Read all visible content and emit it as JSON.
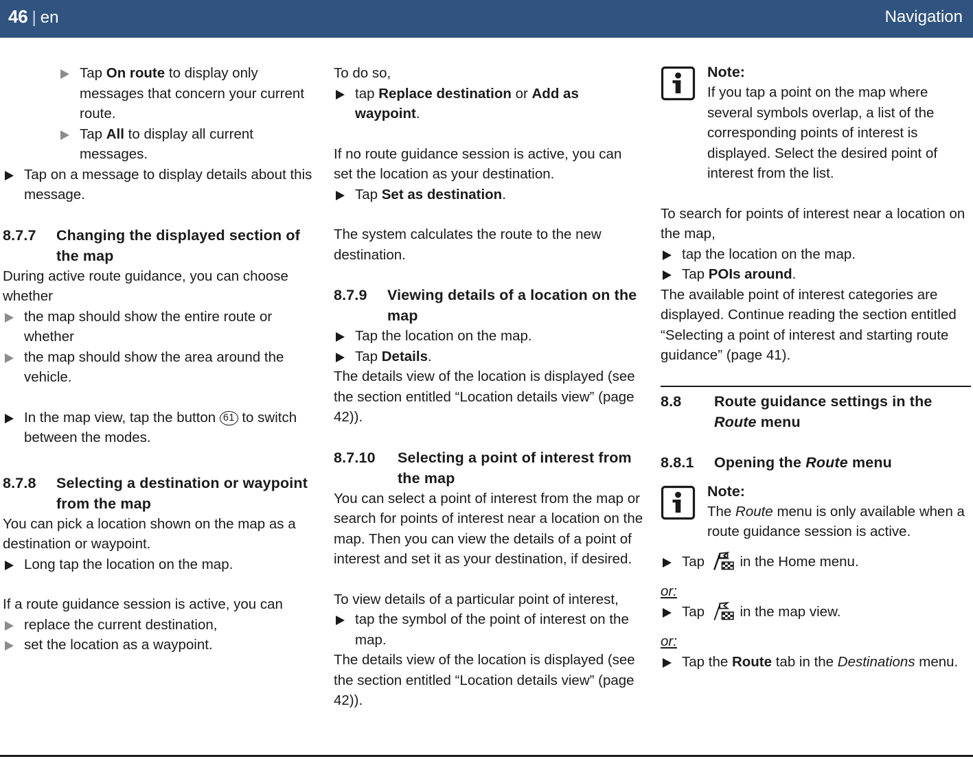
{
  "header": {
    "page_number": "46",
    "separator": "|",
    "language": "en",
    "title": "Navigation"
  },
  "icons": {
    "note_icon": "info-icon",
    "route_icon": "route-flag-icon",
    "bullet": "triangle-bullet-icon"
  },
  "column1": {
    "b1_pre": "Tap ",
    "b1_bold": "On route",
    "b1_post": " to display only messages that concern your current route.",
    "b2_pre": "Tap ",
    "b2_bold": "All",
    "b2_post": " to display all current messages.",
    "b3": "Tap on a message to display details about this message.",
    "h877_num": "8.7.7",
    "h877_title": "Changing the displayed section of the map",
    "p1": "During active route guidance, you can choose whether",
    "b4": "the map should show the entire route or whether",
    "b5": "the map should show the area around the vehicle.",
    "b6_pre": "In the map view, tap the button ",
    "b6_ref": "61",
    "b6_post": " to switch between the modes.",
    "h878_num": "8.7.8",
    "h878_title": "Selecting a destination or waypoint from the map",
    "p2": "You can pick a location shown on the map as a destination or waypoint.",
    "b7": "Long tap the location on the map.",
    "p3": "If a route guidance session is active, you can",
    "b8": "replace the current destination,",
    "b9": "set the location as a waypoint."
  },
  "column2": {
    "p1": "To do so,",
    "b1_pre": "tap ",
    "b1_bold1": "Replace destination",
    "b1_mid": " or ",
    "b1_bold2": "Add as waypoint",
    "b1_post": ".",
    "p2": "If no route guidance session is active, you can set the location as your destination.",
    "b2_pre": "Tap ",
    "b2_bold": "Set as destination",
    "b2_post": ".",
    "p3": "The system calculates the route to the new destination.",
    "h879_num": "8.7.9",
    "h879_title": "Viewing details of a location on the map",
    "b3": "Tap the location on the map.",
    "b4_pre": "Tap ",
    "b4_bold": "Details",
    "b4_post": ".",
    "p4": "The details view of the location is displayed (see the section entitled “Location details view” (page 42)).",
    "h8710_num": "8.7.10",
    "h8710_title": "Selecting a point of interest from the map",
    "p5": "You can select a point of interest from the map or search for points of interest near a location on the map. Then you can view the details of a point of interest and set it as your destination, if desired.",
    "p6": "To view details of a particular point of interest,",
    "b5": "tap the symbol of the point of interest on the map.",
    "p7": "The details view of the location is displayed (see the section entitled “Location details view” (page 42))."
  },
  "column3": {
    "note1_title": "Note:",
    "note1_body": "If you tap a point on the map where several symbols overlap, a list of the corresponding points of interest is displayed. Select the desired point of interest from the list.",
    "p1": "To search for points of interest near a location on the map,",
    "b1": "tap the location on the map.",
    "b2_pre": "Tap ",
    "b2_bold": "POIs around",
    "b2_post": ".",
    "p2": "The available point of interest categories are displayed. Continue reading the section entitled “Selecting a point of interest and starting route guidance” (page 41).",
    "h88_num": "8.8",
    "h88_title_1": "Route guidance settings in the ",
    "h88_title_italic": "Route",
    "h88_title_2": " menu",
    "h881_num": "8.8.1",
    "h881_title_1": "Opening the ",
    "h881_title_italic": "Route",
    "h881_title_2": " menu",
    "note2_title": "Note:",
    "note2_pre": "The ",
    "note2_italic": "Route",
    "note2_post": " menu is only available when a route guidance session is active.",
    "b3_pre": "Tap ",
    "b3_post": " in the Home menu.",
    "or1": "or:",
    "b4_pre": "Tap ",
    "b4_post": " in the map view.",
    "or2": "or:",
    "b5_pre": "Tap the ",
    "b5_bold": "Route",
    "b5_mid": " tab in the ",
    "b5_italic": "Destinations",
    "b5_post": " menu."
  },
  "colors": {
    "header_blue": "#30547f",
    "text": "#1a1a1a",
    "bullet_gray": "#8c8c8c"
  }
}
